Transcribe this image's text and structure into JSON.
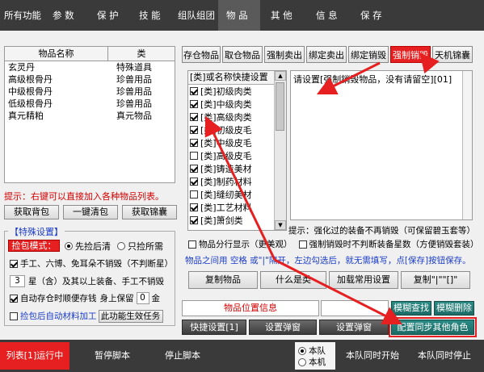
{
  "nav": [
    "所有功能",
    "参 数",
    "保 护",
    "技 能",
    "组队组团",
    "物 品",
    "其 他",
    "信 息",
    "保 存"
  ],
  "item_table": {
    "headers": [
      "物品名称",
      "类"
    ],
    "rows": [
      [
        "玄灵丹",
        "特殊道具"
      ],
      [
        "高级根骨丹",
        "珍兽用品"
      ],
      [
        "中级根骨丹",
        "珍兽用品"
      ],
      [
        "低级根骨丹",
        "珍兽用品"
      ],
      [
        "真元精粕",
        "真元物品"
      ]
    ]
  },
  "hint": "提示：右键可以直接加入各种物品列表。",
  "left_buttons": [
    "获取背包",
    "一键清包",
    "获取锦囊"
  ],
  "special": {
    "title": "【特殊设置】",
    "pickup_mode": "捡包模式：",
    "pick_first": "先捡后清",
    "pick_need": "只捡所需",
    "opt_no_destroy": "手工、六博、免耳朵不销毁（不判断星）",
    "star_value": "3",
    "star_text": "星（含）及其以上装备、手工不销毁",
    "auto_store": "自动存仓时顺便存钱",
    "keep_label": "身上保留",
    "keep_value": "0",
    "keep_unit": "金",
    "auto_material": "捡包后自动材料加工",
    "effect_btn": "此功能生效任务"
  },
  "tabs": [
    "存仓物品",
    "取仓物品",
    "强制卖出",
    "绑定卖出",
    "绑定销毁",
    "强制销毁",
    "天机锦囊"
  ],
  "list_header": "[类]或名称快捷设置",
  "list_items": [
    {
      "label": "[类]初级肉类",
      "checked": true
    },
    {
      "label": "[类]中级肉类",
      "checked": true
    },
    {
      "label": "[类]高级肉类",
      "checked": true
    },
    {
      "label": "[类]初级皮毛",
      "checked": true
    },
    {
      "label": "[类]中级皮毛",
      "checked": true
    },
    {
      "label": "[类]高级皮毛",
      "checked": false
    },
    {
      "label": "[类]铸造美材",
      "checked": true
    },
    {
      "label": "[类]制药材料",
      "checked": true
    },
    {
      "label": "[类]缝纫美材",
      "checked": false
    },
    {
      "label": "[类]工艺材料",
      "checked": true
    },
    {
      "label": "[类]箫剑类",
      "checked": true
    }
  ],
  "textarea_value": "请设置[强制销毁物品，没有请留空][01]",
  "tip2": "提示：强化过的装备不再销毁（可保留碧玉套等）",
  "opt_split": "物品分行显示（更美观）",
  "opt_bound": "强制销毁时不判断装备星数（方便销毁套装）",
  "instruction": "物品之间用 空格 或\"|\"隔开，左边勾选后，就无需填写，点[保存]按钮保存。",
  "mid_buttons": [
    "复制物品",
    "什么是类",
    "加载常用设置",
    "复制\"|\"\"[]\""
  ],
  "position_label": "物品位置信息",
  "fuzzy_find": "模糊查找",
  "fuzzy_delete": "模糊删除",
  "bottom_row": [
    "快捷设置[1]",
    "设置弹窗",
    "设置弹窗"
  ],
  "sync_btn": "配置同步其他角色",
  "footer": {
    "list_run": "列表[1]运行中",
    "pause": "暂停脚本",
    "stop": "停止脚本",
    "team": "本队",
    "local": "本机",
    "team_start": "本队同时开始",
    "team_stop": "本队同时停止"
  },
  "colors": {
    "nav_bg": "#3a3a3a",
    "accent_red": "#e62020",
    "teal": "#1d6b66",
    "hint_red": "#d40000",
    "blue_text": "#1a3cc8"
  }
}
